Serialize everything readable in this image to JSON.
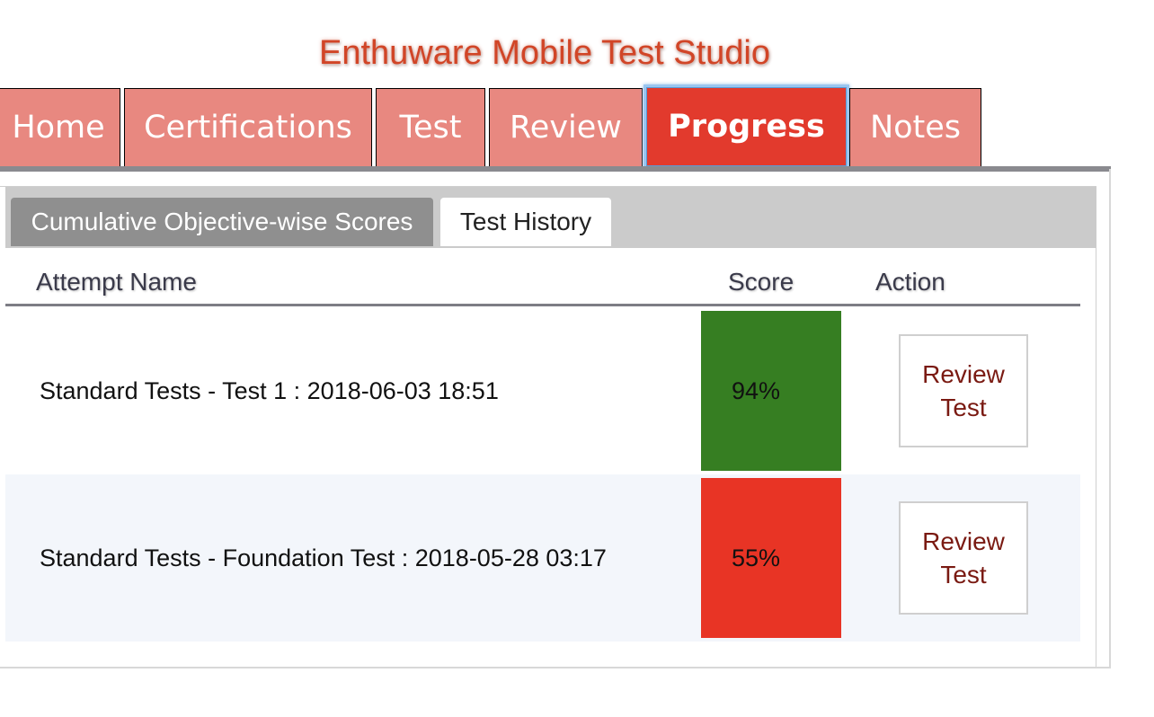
{
  "app": {
    "title": "Enthuware Mobile Test Studio"
  },
  "nav": {
    "tabs": [
      {
        "label": "Home"
      },
      {
        "label": "Certifications"
      },
      {
        "label": "Test"
      },
      {
        "label": "Review"
      },
      {
        "label": "Progress",
        "active": true
      },
      {
        "label": "Notes"
      }
    ]
  },
  "progress": {
    "subtabs": [
      {
        "label": "Cumulative Objective-wise Scores",
        "active": false
      },
      {
        "label": "Test History",
        "active": true
      }
    ],
    "table": {
      "columns": [
        "Attempt Name",
        "Score",
        "Action"
      ],
      "rows": [
        {
          "name": "Standard Tests - Test 1 : 2018-06-03 18:51",
          "score": "94%",
          "score_color": "#367e22",
          "action": "Review Test"
        },
        {
          "name": "Standard Tests - Foundation Test : 2018-05-28 03:17",
          "score": "55%",
          "score_color": "#e83425",
          "action": "Review Test"
        }
      ]
    }
  },
  "colors": {
    "title": "#d14527",
    "tab_bg": "#e88880",
    "tab_active_bg": "#e23a2d",
    "pass": "#367e22",
    "fail": "#e83425",
    "button_text": "#7a1a12"
  }
}
